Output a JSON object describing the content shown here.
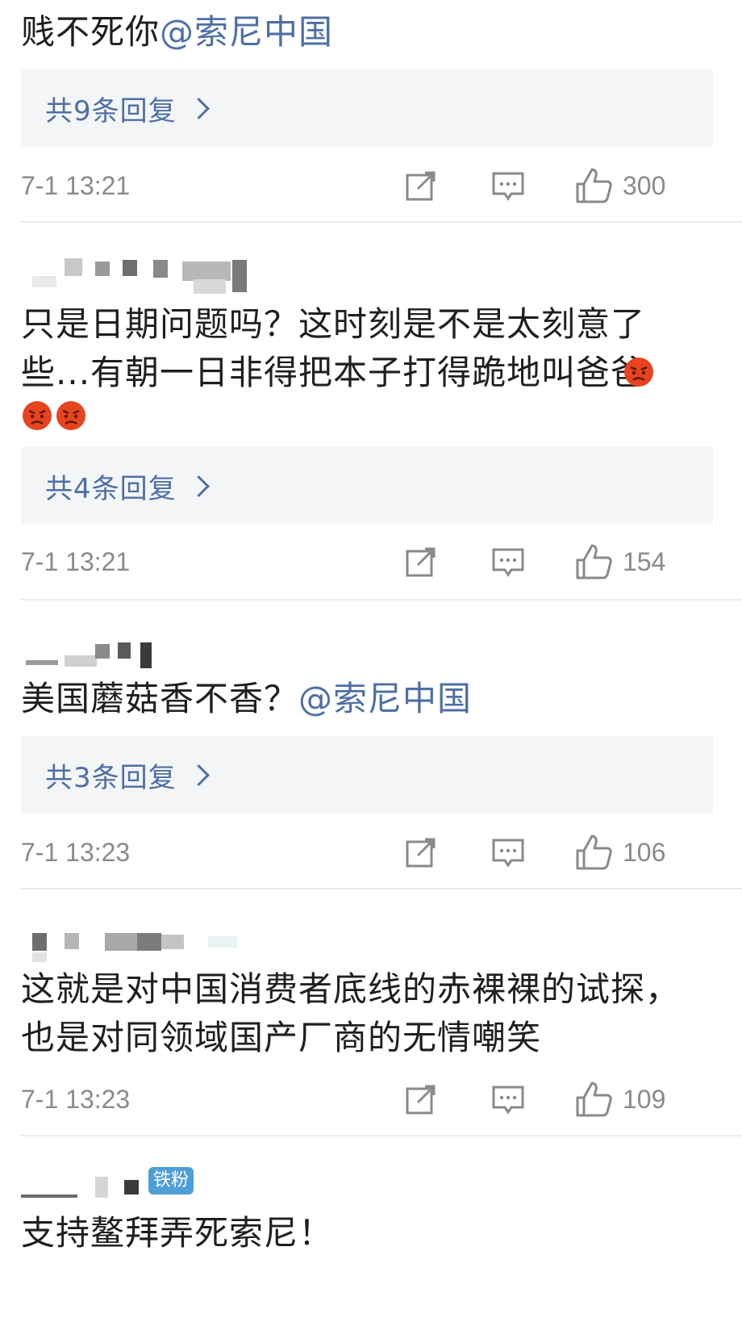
{
  "comments": [
    {
      "text_plain": "贱不死你",
      "mention": "@索尼中国",
      "replies_label": "共9条回复",
      "time": "7-1 13:21",
      "likes": "300"
    },
    {
      "line1": "只是日期问题吗？这时刻是不是太刻意了",
      "line2": "些...有朝一日非得把本子打得跪地叫爸爸",
      "emoji_icon": "angry-face-icon",
      "replies_label": "共4条回复",
      "time": "7-1 13:21",
      "likes": "154"
    },
    {
      "text_plain": "美国蘑菇香不香？",
      "mention": "@索尼中国",
      "replies_label": "共3条回复",
      "time": "7-1 13:23",
      "likes": "106"
    },
    {
      "line1": "这就是对中国消费者底线的赤裸裸的试探，",
      "line2": "也是对同领域国产厂商的无情嘲笑",
      "time": "7-1 13:23",
      "likes": "109"
    },
    {
      "badge": "铁粉",
      "text_plain": "支持鳌拜弄死索尼！"
    }
  ],
  "icons": {
    "share": "share-icon",
    "comment": "comment-icon",
    "like": "thumbs-up-icon"
  },
  "colors": {
    "mention": "#4e6fa5",
    "reply_bg": "#f4f5f7",
    "meta": "#8a8a8a",
    "badge": "#4e9ed8"
  }
}
